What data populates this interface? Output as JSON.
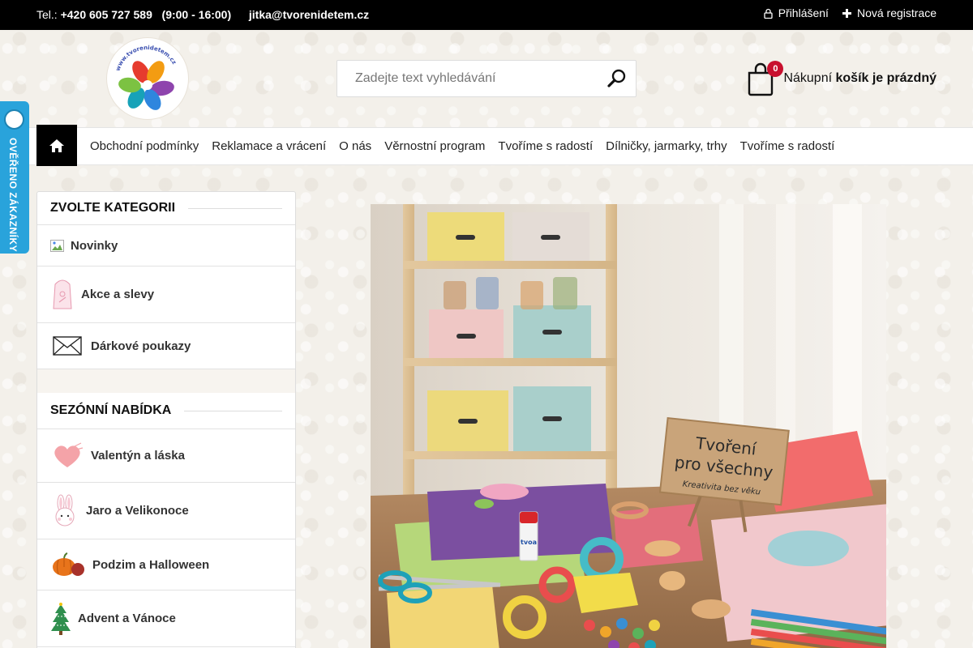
{
  "topbar": {
    "phone_prefix": "Tel.:",
    "phone": "+420 605 727 589",
    "hours": "(9:00 - 16:00)",
    "email": "jitka@tvorenidetem.cz",
    "login": "Přihlášení",
    "register": "Nová registrace"
  },
  "header": {
    "logo_text": "www.tvorenidetem.cz",
    "search_placeholder": "Zadejte text vyhledávání",
    "cart_count": "0",
    "cart_label_prefix": "Nákupní",
    "cart_label_status": "košík je prázdný"
  },
  "nav": {
    "items": [
      "Obchodní podmínky",
      "Reklamace a vrácení",
      "O nás",
      "Věrnostní program",
      "Tvoříme s radostí",
      "Dílničky, jarmarky, trhy",
      "Tvoříme s radostí"
    ]
  },
  "badge": {
    "text": "OVĚŘENO ZÁKAZNÍKY"
  },
  "sidebar": {
    "categories_title": "ZVOLTE KATEGORII",
    "categories": [
      "Novinky",
      "Akce a slevy",
      "Dárkové poukazy"
    ],
    "seasonal_title": "SEZÓNNÍ NABÍDKA",
    "seasonal": [
      "Valentýn a láska",
      "Jaro a Velikonoce",
      "Podzim a Halloween",
      "Advent a Vánoce"
    ]
  },
  "banner": {
    "sign_line1": "Tvoření",
    "sign_line2": "pro všechny",
    "sign_line3": "Kreativita bez věku",
    "glue_label": "tvoa"
  },
  "colors": {
    "topbar": "#000000",
    "badge": "#29a3db",
    "cart_badge": "#c8102e"
  }
}
